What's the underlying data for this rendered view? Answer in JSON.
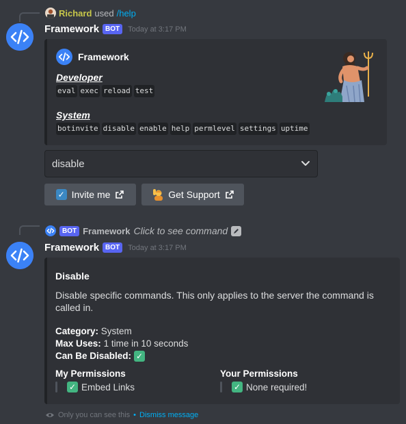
{
  "message1": {
    "reply": {
      "username": "Richard",
      "used_text": "used",
      "command": "/help"
    },
    "author": "Framework",
    "badge": "BOT",
    "timestamp": "Today at 3:17 PM",
    "embed": {
      "author_name": "Framework",
      "fields": [
        {
          "name": "Developer",
          "commands": [
            "eval",
            "exec",
            "reload",
            "test"
          ]
        },
        {
          "name": "System",
          "commands": [
            "botinvite",
            "disable",
            "enable",
            "help",
            "permlevel",
            "settings",
            "uptime"
          ]
        }
      ]
    },
    "select": {
      "value": "disable"
    },
    "buttons": [
      {
        "label": "Invite me",
        "icon": "check-box-icon"
      },
      {
        "label": "Get Support",
        "icon": "person-raising-hand-icon"
      }
    ]
  },
  "message2": {
    "interaction": {
      "badge": "BOT",
      "name": "Framework",
      "click_text": "Click to see command"
    },
    "author": "Framework",
    "badge": "BOT",
    "timestamp": "Today at 3:17 PM",
    "embed": {
      "title": "Disable",
      "description": "Disable specific commands. This only applies to the server the command is called in.",
      "category_label": "Category:",
      "category_value": "System",
      "max_uses_label": "Max Uses:",
      "max_uses_value": "1 time in 10 seconds",
      "can_be_disabled_label": "Can Be Disabled:",
      "my_permissions": {
        "title": "My Permissions",
        "value": "Embed Links"
      },
      "your_permissions": {
        "title": "Your Permissions",
        "value": "None required!"
      }
    },
    "footer": {
      "only_you": "Only you can see this",
      "separator": "•",
      "dismiss": "Dismiss message"
    }
  },
  "colors": {
    "background": "#36393f",
    "embed_bg": "#2f3136",
    "blurple": "#5865f2",
    "link": "#00aff4",
    "check_green": "#43b581"
  }
}
